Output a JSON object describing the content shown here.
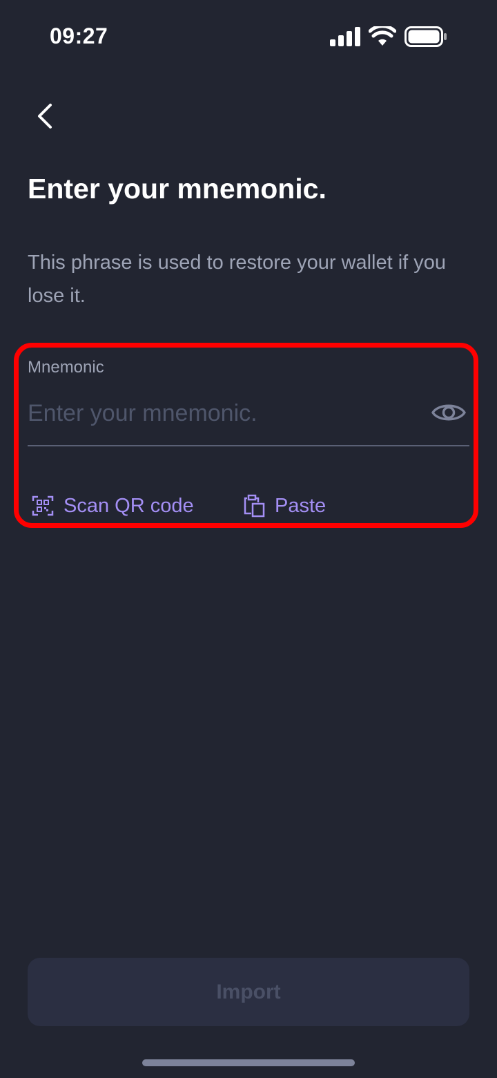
{
  "status_bar": {
    "time": "09:27",
    "icons": [
      "cellular-signal-icon",
      "wifi-icon",
      "battery-icon"
    ]
  },
  "header": {
    "back_icon": "chevron-left-icon"
  },
  "main": {
    "title": "Enter your mnemonic.",
    "subtitle": "This phrase is used to restore your wallet if you lose it.",
    "mnemonic_field": {
      "label": "Mnemonic",
      "value": "",
      "placeholder": "Enter your mnemonic.",
      "visibility_icon": "eye-icon"
    },
    "actions": {
      "scan_label": "Scan QR code",
      "scan_icon": "qr-scan-icon",
      "paste_label": "Paste",
      "paste_icon": "clipboard-icon"
    }
  },
  "footer": {
    "import_label": "Import"
  },
  "colors": {
    "background": "#222531",
    "accent": "#a48ff5",
    "highlight": "#ff0000",
    "muted_text": "#9ea4b6",
    "disabled_button": "#2b2f42"
  }
}
